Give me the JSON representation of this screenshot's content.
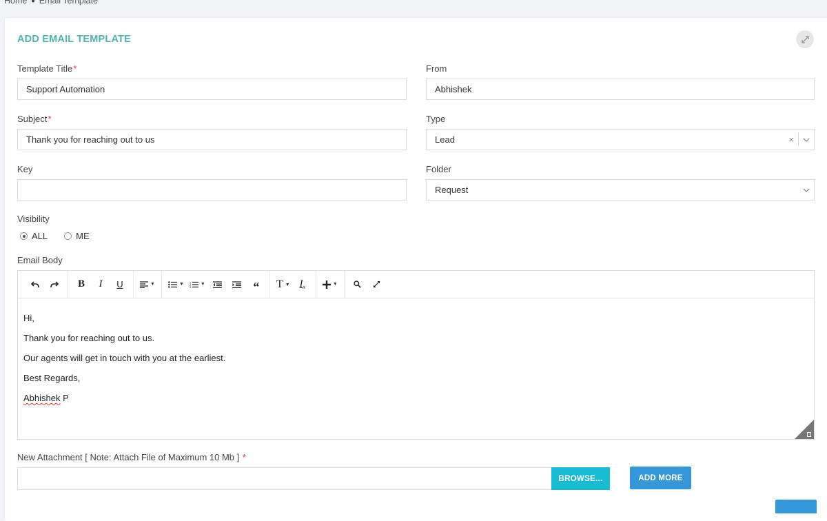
{
  "breadcrumb": {
    "home": "Home",
    "current": "Email Template"
  },
  "form": {
    "title": "ADD EMAIL TEMPLATE",
    "template_title": {
      "label": "Template Title",
      "required_mark": "*",
      "value": "Support Automation"
    },
    "from": {
      "label": "From",
      "value": "Abhishek"
    },
    "subject": {
      "label": "Subject",
      "required_mark": "*",
      "value": "Thank you for reaching out to us"
    },
    "type": {
      "label": "Type",
      "value": "Lead",
      "clear": "×"
    },
    "key": {
      "label": "Key",
      "value": ""
    },
    "folder": {
      "label": "Folder",
      "value": "Request"
    },
    "visibility": {
      "label": "Visibility",
      "options": [
        {
          "label": "ALL",
          "checked": true
        },
        {
          "label": "ME",
          "checked": false
        }
      ]
    },
    "email_body": {
      "label": "Email Body",
      "toolbar": {
        "bold": "B",
        "italic": "I",
        "underline": "U",
        "quote": "66",
        "text_style": "T",
        "clear_format": "Ix",
        "icons": [
          "undo-icon",
          "redo-icon",
          "bold-icon",
          "italic-icon",
          "underline-icon",
          "align-icon",
          "bullet-list-icon",
          "numbered-list-icon",
          "outdent-icon",
          "indent-icon",
          "quote-icon",
          "font-size-icon",
          "clear-format-icon",
          "insert-icon",
          "search-icon",
          "fullscreen-icon"
        ]
      },
      "lines": [
        "Hi,",
        "Thank you for reaching out to us.",
        "Our agents will get in touch with you at the earliest.",
        "Best Regards,"
      ],
      "signature_first": "Abhishek",
      "signature_last": " P"
    },
    "attachment": {
      "label": "New Attachment [ Note: Attach File of Maximum 10 Mb ]",
      "required_mark": "*",
      "browse_label": "BROWSE...",
      "add_more_label": "ADD MORE"
    }
  },
  "colors": {
    "title": "#4fb2b3",
    "browse": "#17bcd3",
    "add_more": "#3497d9",
    "required": "#e53935"
  }
}
